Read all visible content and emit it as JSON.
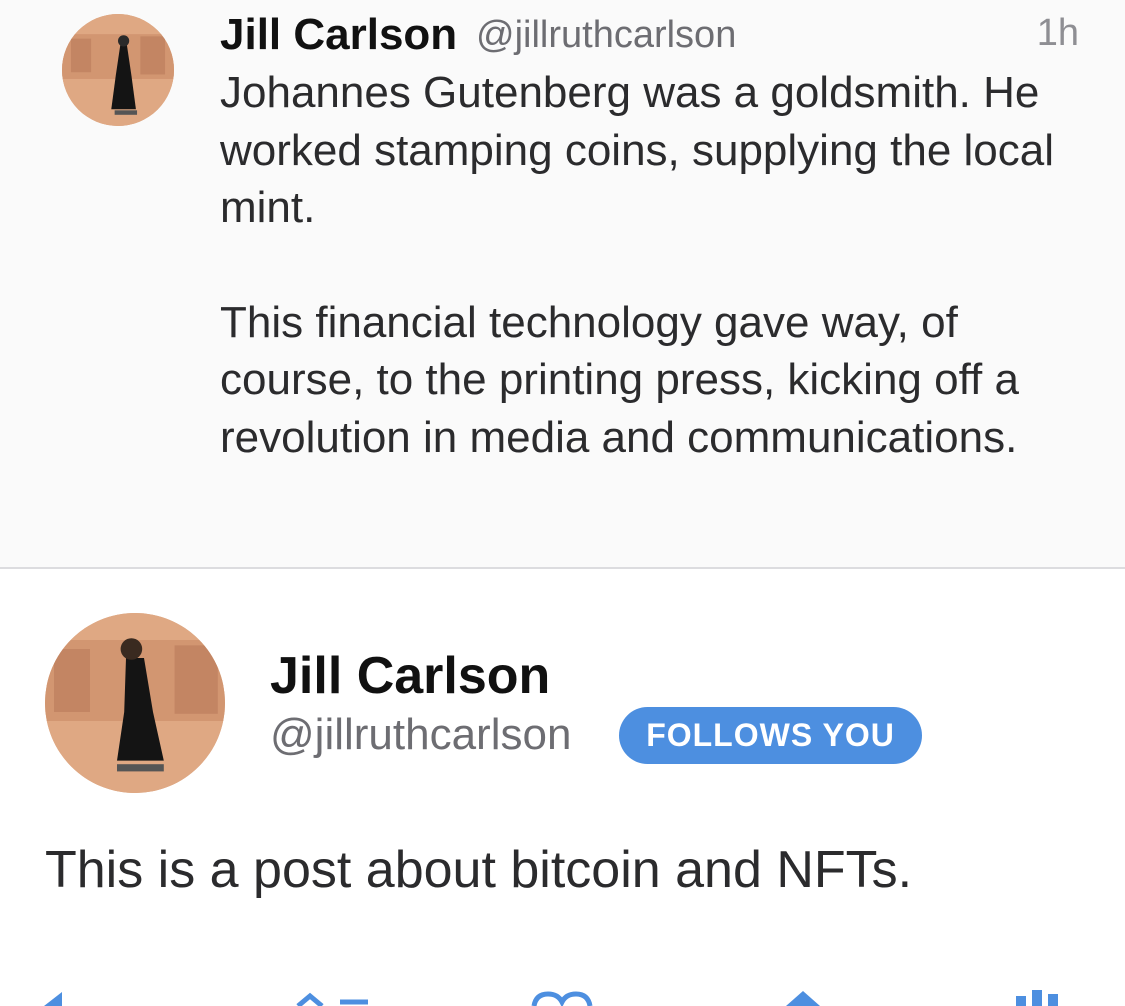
{
  "tweet_top": {
    "author_name": "Jill Carlson",
    "author_handle": "@jillruthcarlson",
    "timestamp": "1h",
    "paragraphs": [
      "Johannes Gutenberg was a goldsmith. He worked stamping coins, supplying the local mint.",
      "This financial technology gave way, of course, to the printing press, kicking off a revolution in media and communications."
    ]
  },
  "tweet_main": {
    "author_name": "Jill Carlson",
    "author_handle": "@jillruthcarlson",
    "follows_badge": "FOLLOWS YOU",
    "text": "This is a post about bitcoin and NFTs."
  },
  "actions": {
    "icons": [
      "reply-icon",
      "retweet-icon",
      "like-icon",
      "share-icon",
      "analytics-icon"
    ],
    "color": "#4d8fe0"
  }
}
